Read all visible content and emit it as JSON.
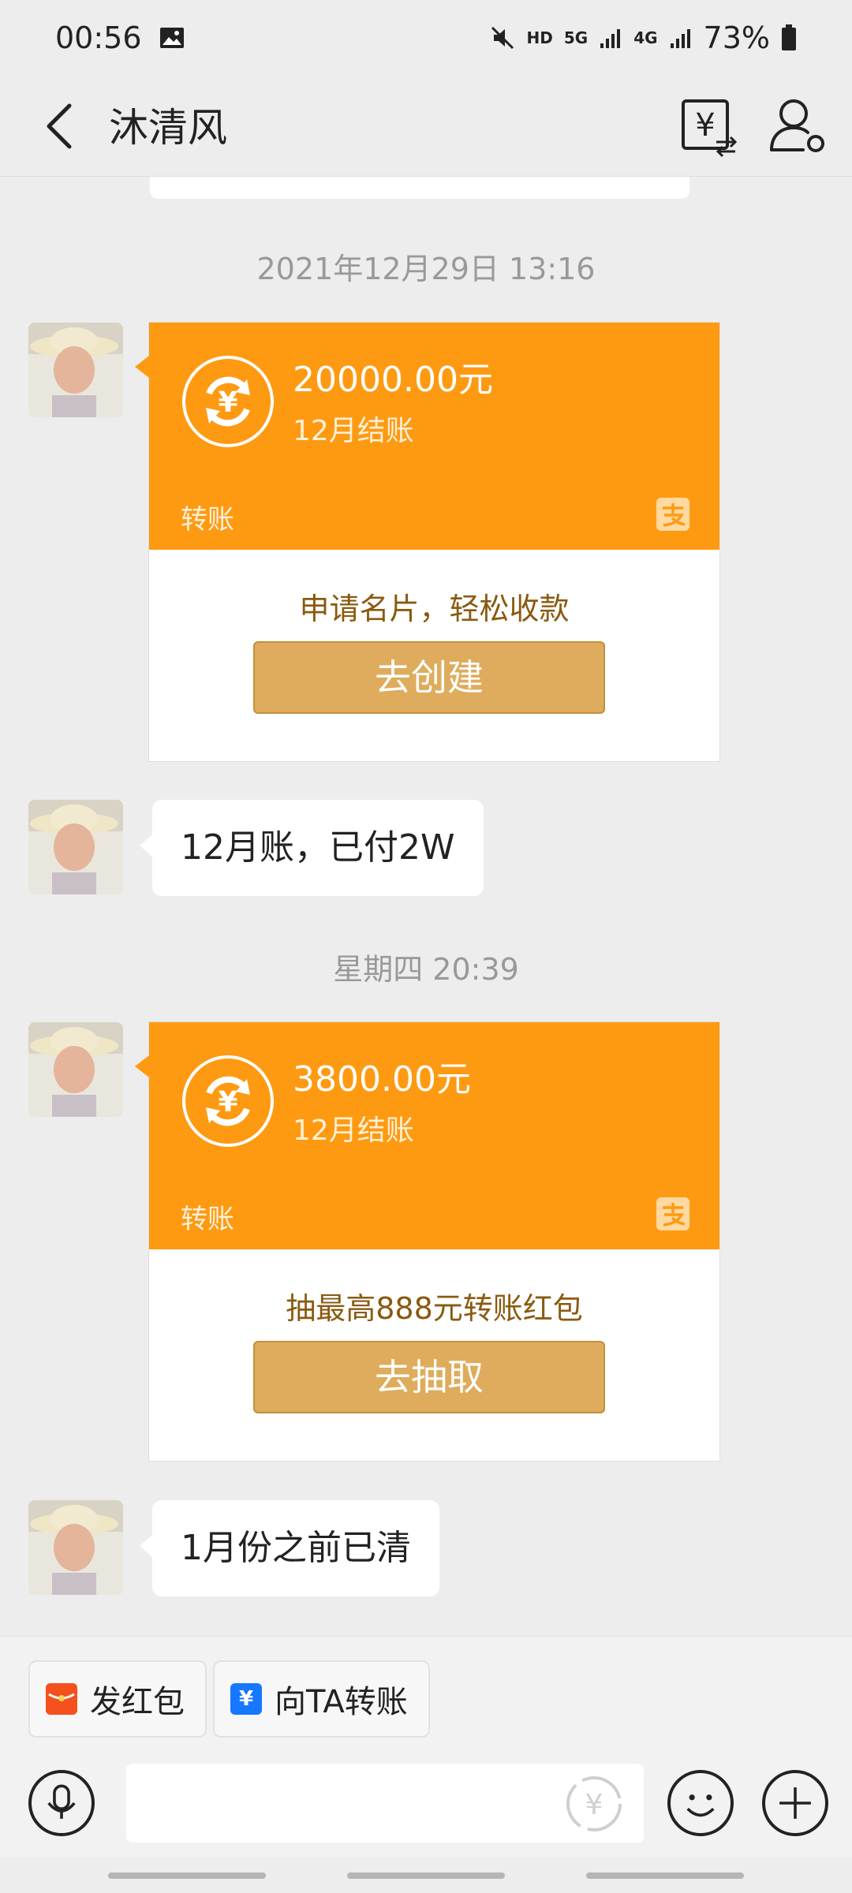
{
  "status": {
    "time": "00:56",
    "hd": "HD",
    "sig5g": "5G",
    "sig4g": "4G",
    "battery": "73%"
  },
  "header": {
    "title": "沐清风"
  },
  "messages": {
    "sep1": "2021年12月29日 13:16",
    "card1": {
      "amount": "20000.00元",
      "memo": "12月结账",
      "kind": "转账",
      "promo": "申请名片，轻松收款",
      "button": "去创建"
    },
    "bubble1": "12月账，已付2W",
    "sep2": "星期四 20:39",
    "card2": {
      "amount": "3800.00元",
      "memo": "12月结账",
      "kind": "转账",
      "promo": "抽最高888元转账红包",
      "button": "去抽取"
    },
    "bubble2": "1月份之前已清"
  },
  "quick": {
    "red_packet": "发红包",
    "transfer": "向TA转账"
  },
  "colors": {
    "orange": "#fe9a12",
    "gold_button": "#deac5c",
    "background": "#ededed"
  }
}
